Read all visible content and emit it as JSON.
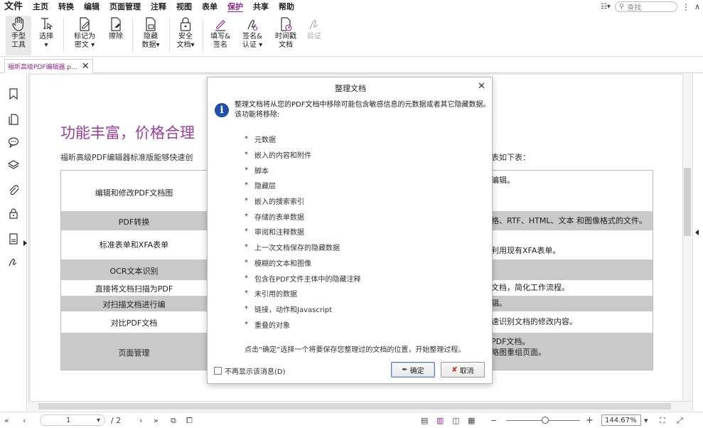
{
  "menubar": {
    "items": [
      "文件",
      "主页",
      "转换",
      "编辑",
      "页面管理",
      "注释",
      "视图",
      "表单",
      "保护",
      "共享",
      "帮助"
    ],
    "active": "保护",
    "search_placeholder": "查找"
  },
  "ribbon": {
    "buttons": [
      {
        "label1": "手型",
        "label2": "工具",
        "icon": "hand-icon"
      },
      {
        "label1": "选择",
        "label2": "▾",
        "icon": "select-cursor-icon"
      },
      {
        "label1": "标记为",
        "label2": "密文 ▾",
        "icon": "mark-redaction-icon"
      },
      {
        "label1": "擦除",
        "label2": "",
        "icon": "erase-icon"
      },
      {
        "label1": "隐藏",
        "label2": "数据▾",
        "icon": "hide-data-icon"
      },
      {
        "label1": "安全",
        "label2": "文档▾",
        "icon": "lock-icon"
      },
      {
        "label1": "填写&",
        "label2": "签名",
        "icon": "fill-sign-icon"
      },
      {
        "label1": "签名&",
        "label2": "认证 ▾",
        "icon": "sign-certify-icon"
      },
      {
        "label1": "时间戳",
        "label2": "文档",
        "icon": "timestamp-icon"
      },
      {
        "label1": "验证",
        "label2": "",
        "icon": "validate-icon"
      }
    ]
  },
  "tab": {
    "title": "福昕高级PDF编辑器.p..."
  },
  "page": {
    "title": "功能丰富，价格合理",
    "intro_left": "福昕高级PDF编辑器标准版能够快速创",
    "intro_right": "表如下表：",
    "rows": [
      {
        "left": "编辑和修改PDF文档图",
        "right": "编辑。"
      },
      {
        "left": "PDF转换",
        "right": "格、RTF、HTML、文本 和图像格式的文件。"
      },
      {
        "left": "标准表单和XFA表单",
        "right": "利用现有XFA表单。"
      },
      {
        "left": "OCR文本识别",
        "right": ""
      },
      {
        "left": "直接将文档扫描为PDF",
        "right": "文档，简化工作流程。"
      },
      {
        "left": "对扫描文档进行编",
        "right": "辑。"
      },
      {
        "left": "对比PDF文档",
        "right": "速识别文档的修改内容。"
      },
      {
        "left": "页面管理",
        "right": "PDF文档。",
        "right2": "略图重组页面。"
      }
    ]
  },
  "dialog": {
    "title": "整理文档",
    "description": "整理文档将从您的PDF文档中移除可能包含敏感信息的元数据或者其它隐藏数据。该功能将移除:",
    "items": [
      "元数据",
      "嵌入的内容和附件",
      "脚本",
      "隐藏层",
      "嵌入的搜索索引",
      "存储的表单数据",
      "审阅和注释数据",
      "上一次文档保存的隐藏数据",
      "模糊的文本和图像",
      "包含在PDF文件主体中的隐藏注释",
      "未引用的数据",
      "链接，动作和Javascript",
      "重叠的对象"
    ],
    "note": "点击“确定”选择一个将要保存您整理过的文档的位置，开始整理过程。",
    "dont_show": "不再显示该消息(D)",
    "ok_label": "确定",
    "cancel_label": "取消"
  },
  "status": {
    "current_page": "1",
    "total_pages": "/ 2",
    "zoom": "144.67%"
  },
  "colors": {
    "accent": "#8a2a8c",
    "info": "#1f4fa8",
    "row_gray": "#c9c9c9"
  }
}
